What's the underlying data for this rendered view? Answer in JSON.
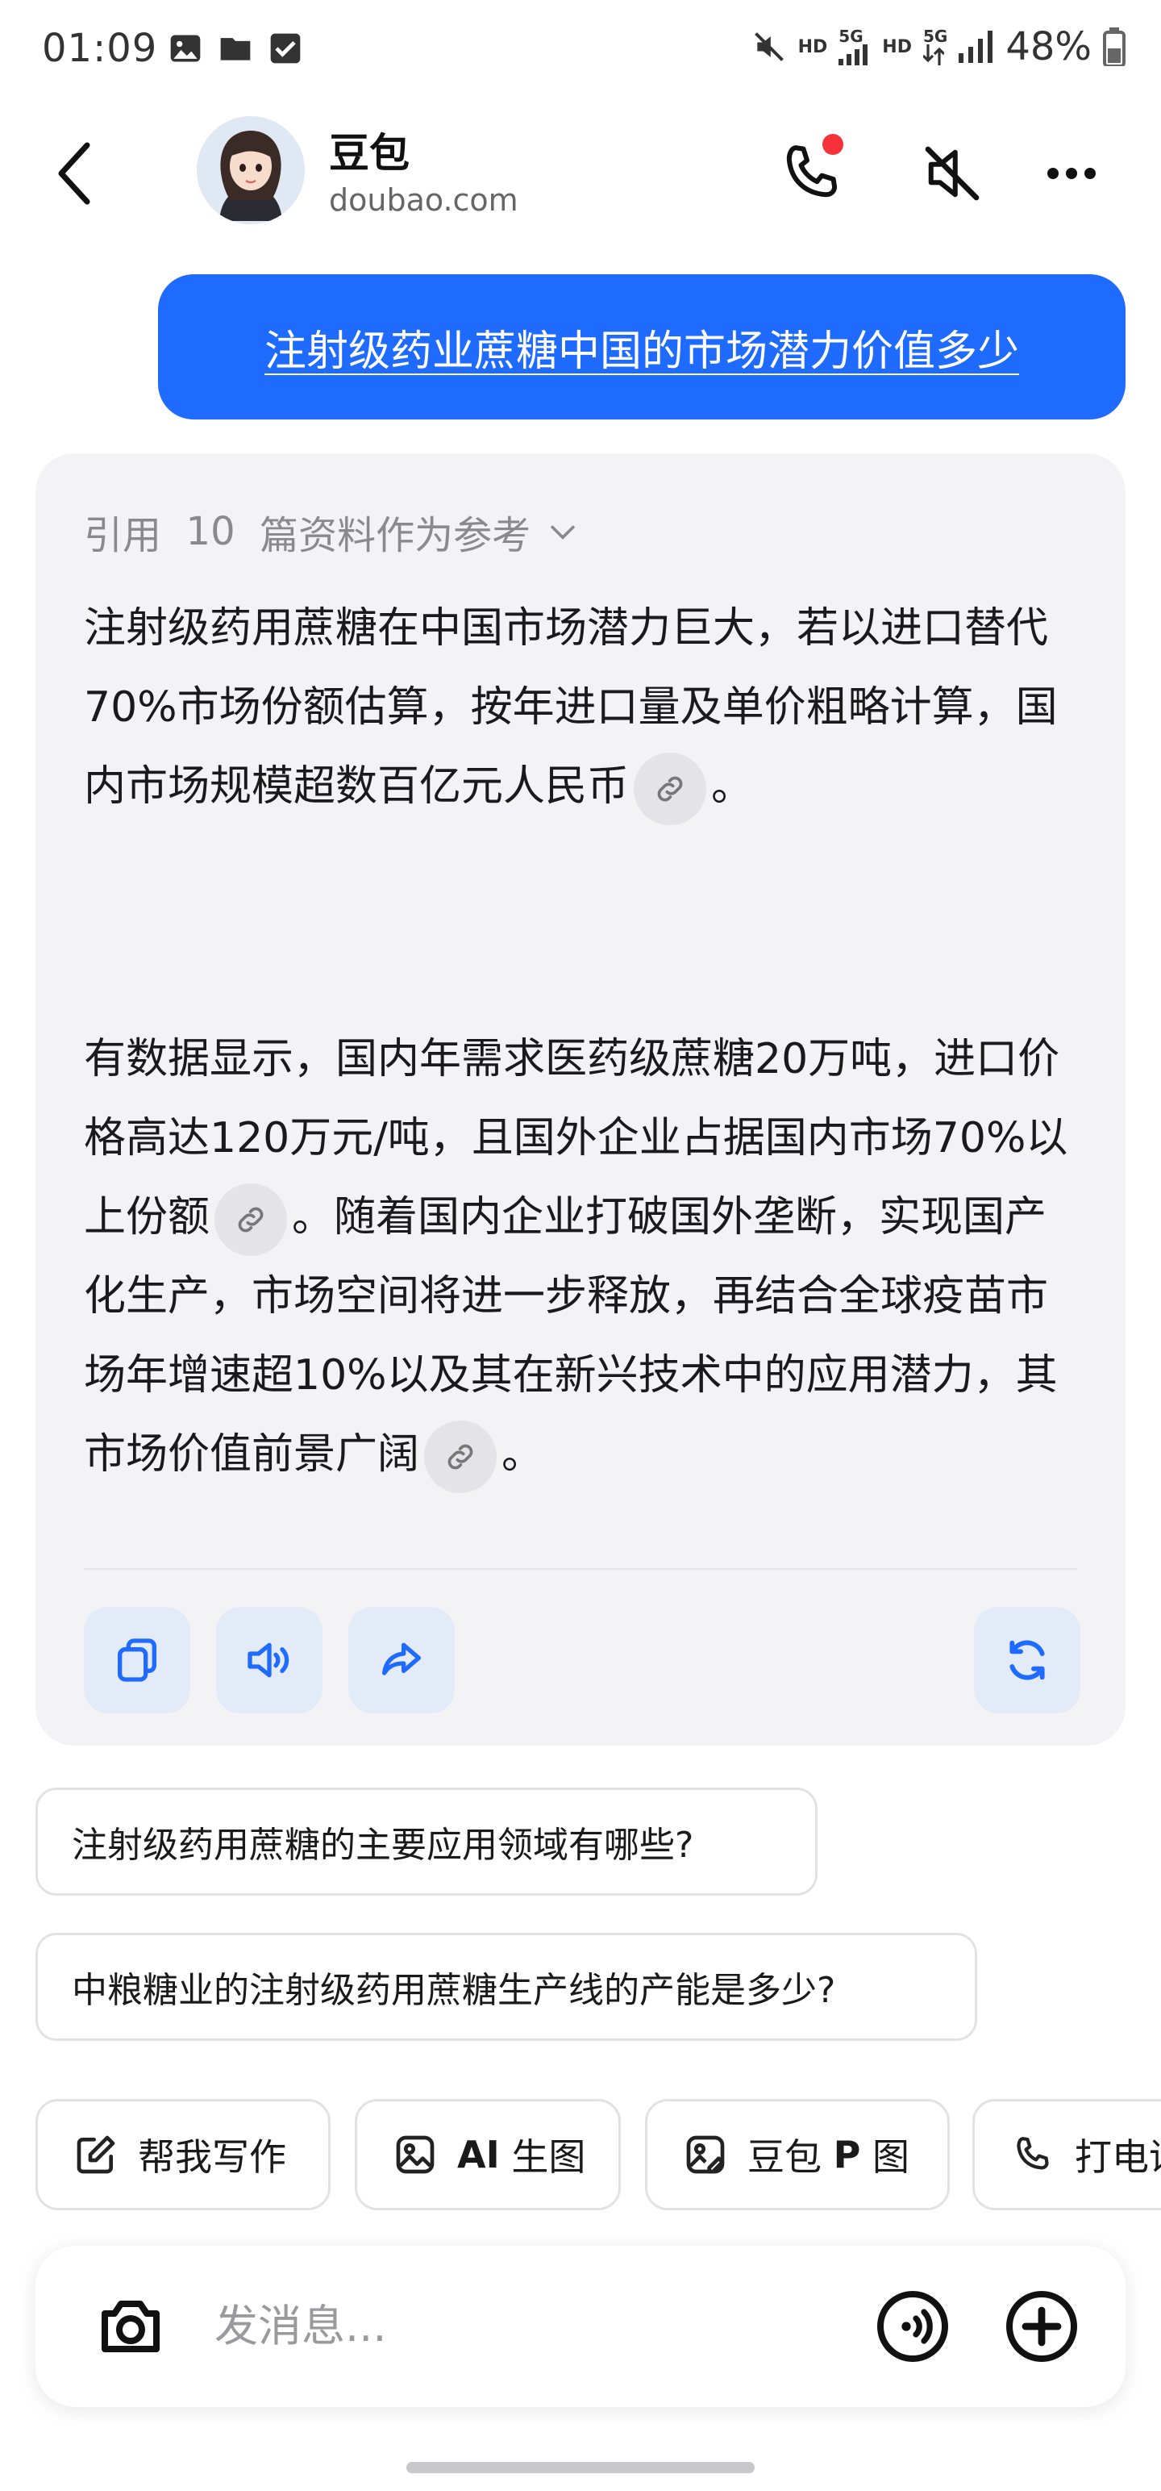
{
  "status_bar": {
    "time": "01:09",
    "hd1": "HD",
    "net1": "5G",
    "hd2": "HD",
    "net2": "5G",
    "battery": "48%",
    "icons": [
      "image-icon",
      "folder-icon",
      "checkbox-icon",
      "mute-icon",
      "signal-icon",
      "battery-icon"
    ]
  },
  "header": {
    "title": "豆包",
    "subtitle": "doubao.com",
    "icons": [
      "back-icon",
      "phone-icon",
      "speaker-muted-icon",
      "more-icon"
    ],
    "notification_color": "#f5313a"
  },
  "user_message": {
    "text": "注射级药业蔗糖中国的市场潜力价值多少",
    "bubble_color": "#1f6bff"
  },
  "answer": {
    "reference": {
      "prefix": "引用",
      "count": "10",
      "suffix": "篇资料作为参考"
    },
    "paragraph1": {
      "text": "注射级药用蔗糖在中国市场潜力巨大，若以进口替代70%市场份额估算，按年进口量及单价粗略计算，国内市场规模超数百亿元人民币",
      "end": "。"
    },
    "paragraph2": {
      "part1": "有数据显示，国内年需求医药级蔗糖20万吨，进口价格高达120万元/吨，且国外企业占据国内市场70%以上份额",
      "part2": "。随着国内企业打破国外垄断，实现国产化生产，市场空间将进一步释放，再结合全球疫苗市场年增速超10%以及其在新兴技术中的应用潜力，其市场价值前景广阔",
      "end": "。"
    },
    "actions": [
      "copy-icon",
      "read-aloud-icon",
      "share-icon",
      "regenerate-icon"
    ],
    "action_color": "#1f6bff"
  },
  "suggestions": [
    "注射级药用蔗糖的主要应用领域有哪些?",
    "中粮糖业的注射级药用蔗糖生产线的产能是多少?"
  ],
  "chips": [
    {
      "icon": "edit-icon",
      "label": "帮我写作"
    },
    {
      "icon": "image-gen-icon",
      "label_bold": "AI",
      "label": " 生图"
    },
    {
      "icon": "image-edit-icon",
      "label_pre": "豆包 ",
      "label_bold": "P",
      "label": " 图"
    },
    {
      "icon": "phone-icon",
      "label": "打电话"
    }
  ],
  "input": {
    "placeholder": "发消息..."
  }
}
